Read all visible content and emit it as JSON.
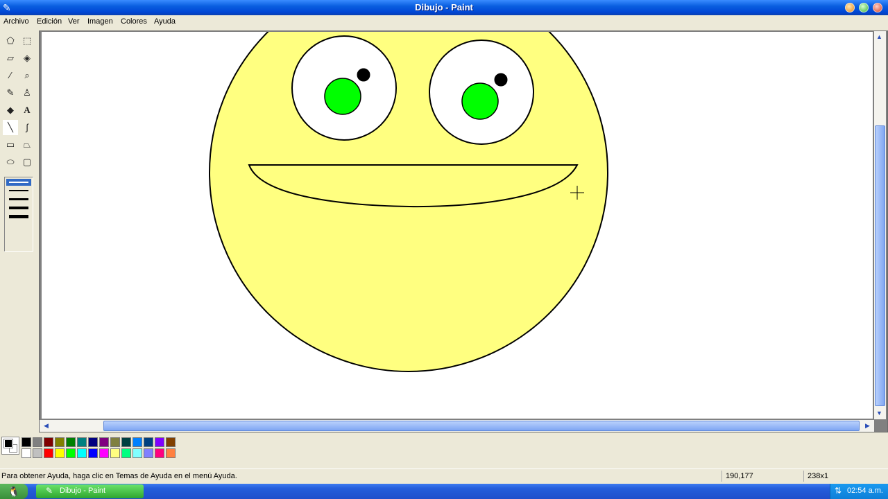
{
  "window": {
    "title": "Dibujo - Paint"
  },
  "menu": [
    "Archivo",
    "Edición",
    "Ver",
    "Imagen",
    "Colores",
    "Ayuda"
  ],
  "tools": [
    "free-select-icon",
    "rect-select-icon",
    "eraser-icon",
    "fill-bucket-icon",
    "color-picker-icon",
    "magnifier-icon",
    "pencil-icon",
    "brush-icon",
    "airbrush-icon",
    "text-icon",
    "line-icon",
    "curve-icon",
    "rectangle-icon",
    "polygon-icon",
    "ellipse-icon",
    "rounded-rect-icon"
  ],
  "palette": {
    "foreground": "#000000",
    "background": "#FFFFFF",
    "row1": [
      "#000000",
      "#808080",
      "#800000",
      "#808000",
      "#008000",
      "#008080",
      "#000080",
      "#800080",
      "#808040",
      "#004040",
      "#0080FF",
      "#004080",
      "#8000FF",
      "#804000"
    ],
    "row2": [
      "#FFFFFF",
      "#C0C0C0",
      "#FF0000",
      "#FFFF00",
      "#00FF00",
      "#00FFFF",
      "#0000FF",
      "#FF00FF",
      "#FFFF80",
      "#00FF80",
      "#80FFFF",
      "#8080FF",
      "#FF0080",
      "#FF8040"
    ]
  },
  "drawing": {
    "face_color": "#FFFF80",
    "eye_white": "#FFFFFF",
    "iris_color": "#00FF00",
    "pupil_color": "#000000",
    "outline_color": "#000000"
  },
  "status": {
    "help": "Para obtener Ayuda, haga clic en Temas de Ayuda en el menú Ayuda.",
    "coords": "190,177",
    "size": "238x1"
  },
  "taskbar": {
    "task_label": "Dibujo - Paint",
    "clock": "02:54 a.m."
  }
}
